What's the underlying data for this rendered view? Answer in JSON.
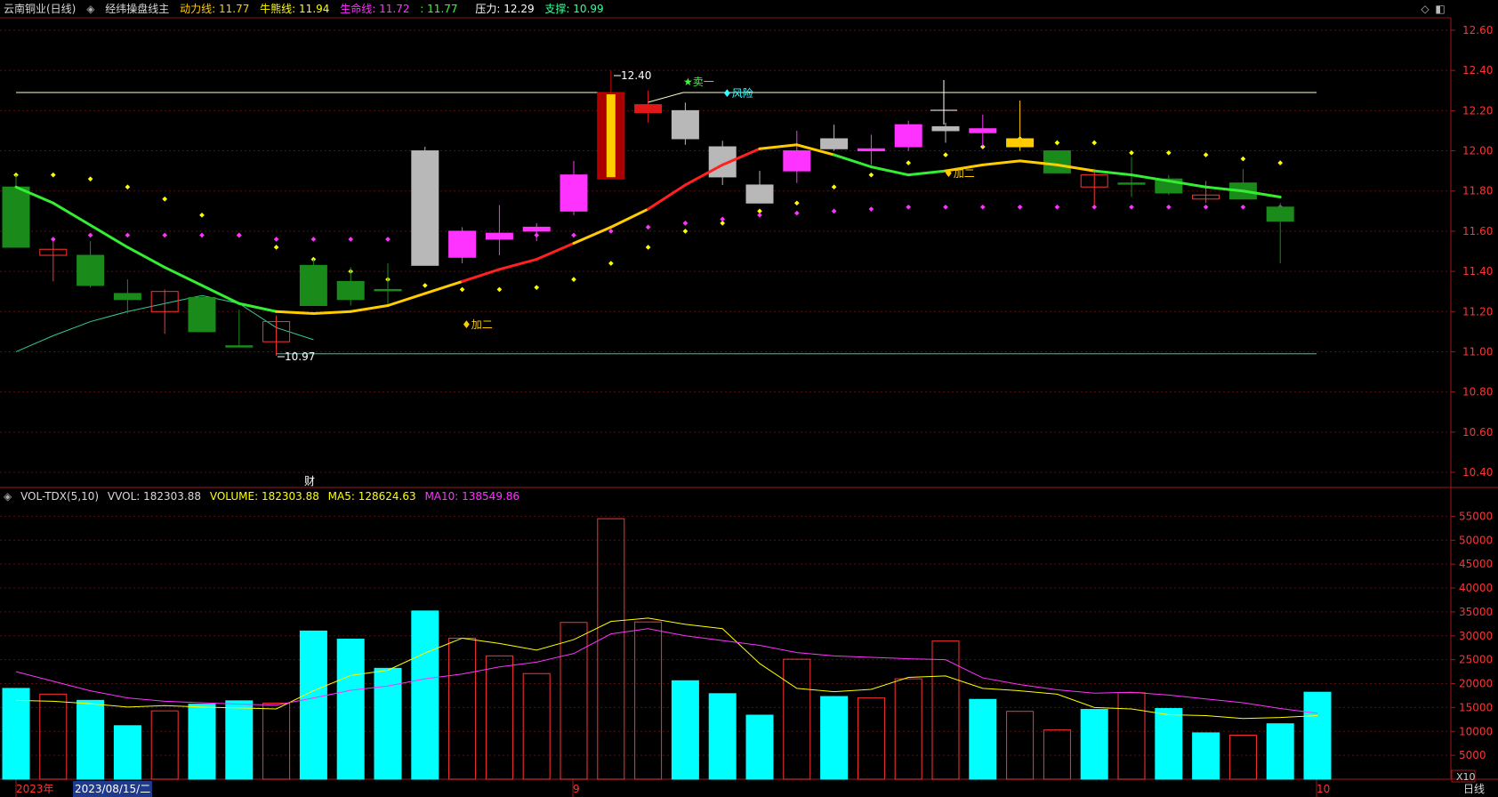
{
  "header": {
    "title": "云南铜业(日线)",
    "indicator_name": "经纬操盘线主",
    "dynamic_label": "动力线:",
    "dynamic_value": "11.77",
    "bull_label": "牛熊线:",
    "bull_value": "11.94",
    "life_label": "生命线:",
    "life_value": "11.72",
    "extra_label": ":",
    "extra_value": "11.77",
    "resist_label": "压力:",
    "resist_value": "12.29",
    "support_label": "支撑:",
    "support_value": "10.99",
    "colors": {
      "dynamic": "#ffcc00",
      "bull": "#ffff00",
      "life": "#ff33ff",
      "extra": "#33ff33",
      "resist": "#ffffff",
      "support": "#33ff99"
    }
  },
  "price_axis": {
    "ticks": [
      "12.60",
      "12.40",
      "12.20",
      "12.00",
      "11.80",
      "11.60",
      "11.40",
      "11.20",
      "11.00",
      "10.80",
      "10.60",
      "10.40"
    ]
  },
  "annotations": {
    "high": "12.40",
    "low": "10.97",
    "sell1": "★卖一",
    "risk": "♦风险",
    "add2_a": "♦加二",
    "add2_b": "♦加二",
    "finance": "财"
  },
  "volume": {
    "name": "VOL-TDX(5,10)",
    "vvol": "VVOL: 182303.88",
    "volume": "VOLUME: 182303.88",
    "ma5": "MA5: 128624.63",
    "ma10": "MA10: 138549.86",
    "axis_ticks": [
      "55000",
      "50000",
      "45000",
      "40000",
      "35000",
      "30000",
      "25000",
      "20000",
      "15000",
      "10000",
      "5000"
    ],
    "unit": "X10"
  },
  "datebar": {
    "year": "2023年",
    "cursor_date": "2023/08/15/二",
    "month9": "9",
    "month10": "10",
    "period": "日线"
  },
  "colors": {
    "up": "#ff3333",
    "down_green": "#1a8a1a",
    "magenta": "#ff33ff",
    "cyan": "#00ffff",
    "yellow": "#ffff00",
    "gray": "#aaaaaa"
  },
  "chart_data": {
    "type": "candlestick",
    "ylim": [
      10.4,
      12.6
    ],
    "candles": [
      {
        "o": 11.82,
        "h": 11.88,
        "l": 11.52,
        "c": 11.52,
        "col": "green"
      },
      {
        "o": 11.48,
        "h": 11.55,
        "l": 11.35,
        "c": 11.51,
        "col": "redh"
      },
      {
        "o": 11.48,
        "h": 11.55,
        "l": 11.32,
        "c": 11.33,
        "col": "green"
      },
      {
        "o": 11.29,
        "h": 11.36,
        "l": 11.19,
        "c": 11.26,
        "col": "green"
      },
      {
        "o": 11.2,
        "h": 11.31,
        "l": 11.09,
        "c": 11.3,
        "col": "redh"
      },
      {
        "o": 11.27,
        "h": 11.28,
        "l": 11.1,
        "c": 11.1,
        "col": "green"
      },
      {
        "o": 11.03,
        "h": 11.21,
        "l": 11.03,
        "c": 11.03,
        "col": "green"
      },
      {
        "o": 11.05,
        "h": 11.18,
        "l": 10.98,
        "c": 11.15,
        "col": "redh"
      },
      {
        "o": 11.43,
        "h": 11.46,
        "l": 11.23,
        "c": 11.23,
        "col": "green"
      },
      {
        "o": 11.35,
        "h": 11.42,
        "l": 11.23,
        "c": 11.26,
        "col": "green"
      },
      {
        "o": 11.31,
        "h": 11.44,
        "l": 11.23,
        "c": 11.31,
        "col": "green"
      },
      {
        "o": 11.43,
        "h": 12.02,
        "l": 11.43,
        "c": 12.0,
        "col": "gray"
      },
      {
        "o": 11.47,
        "h": 11.62,
        "l": 11.44,
        "c": 11.6,
        "col": "magenta"
      },
      {
        "o": 11.56,
        "h": 11.73,
        "l": 11.48,
        "c": 11.59,
        "col": "magenta"
      },
      {
        "o": 11.6,
        "h": 11.64,
        "l": 11.55,
        "c": 11.62,
        "col": "magenta"
      },
      {
        "o": 11.7,
        "h": 11.95,
        "l": 11.68,
        "c": 11.88,
        "col": "magenta"
      },
      {
        "o": 11.86,
        "h": 12.4,
        "l": 11.86,
        "c": 12.29,
        "col": "bigred"
      },
      {
        "o": 12.23,
        "h": 12.3,
        "l": 12.14,
        "c": 12.19,
        "col": "red"
      },
      {
        "o": 12.2,
        "h": 12.24,
        "l": 12.03,
        "c": 12.06,
        "col": "gray"
      },
      {
        "o": 12.02,
        "h": 12.05,
        "l": 11.83,
        "c": 11.87,
        "col": "gray"
      },
      {
        "o": 11.83,
        "h": 11.9,
        "l": 11.74,
        "c": 11.74,
        "col": "gray"
      },
      {
        "o": 11.9,
        "h": 12.1,
        "l": 11.84,
        "c": 12.0,
        "col": "magenta"
      },
      {
        "o": 12.06,
        "h": 12.13,
        "l": 12.0,
        "c": 12.01,
        "col": "gray"
      },
      {
        "o": 12.0,
        "h": 12.08,
        "l": 11.93,
        "c": 12.01,
        "col": "magenta"
      },
      {
        "o": 12.02,
        "h": 12.15,
        "l": 12.0,
        "c": 12.13,
        "col": "magenta"
      },
      {
        "o": 12.12,
        "h": 12.14,
        "l": 12.04,
        "c": 12.1,
        "col": "gray"
      },
      {
        "o": 12.09,
        "h": 12.18,
        "l": 12.02,
        "c": 12.11,
        "col": "magenta"
      },
      {
        "o": 12.06,
        "h": 12.25,
        "l": 12.0,
        "c": 12.02,
        "col": "gold"
      },
      {
        "o": 12.0,
        "h": 12.0,
        "l": 11.89,
        "c": 11.89,
        "col": "green"
      },
      {
        "o": 11.82,
        "h": 11.91,
        "l": 11.73,
        "c": 11.88,
        "col": "redh"
      },
      {
        "o": 11.84,
        "h": 11.97,
        "l": 11.77,
        "c": 11.84,
        "col": "green"
      },
      {
        "o": 11.86,
        "h": 11.88,
        "l": 11.78,
        "c": 11.79,
        "col": "green"
      },
      {
        "o": 11.76,
        "h": 11.85,
        "l": 11.74,
        "c": 11.78,
        "col": "redh"
      },
      {
        "o": 11.84,
        "h": 11.91,
        "l": 11.76,
        "c": 11.76,
        "col": "green"
      },
      {
        "o": 11.72,
        "h": 11.74,
        "l": 11.44,
        "c": 11.65,
        "col": "green"
      }
    ],
    "ma_line": [
      11.82,
      11.74,
      11.63,
      11.52,
      11.42,
      11.33,
      11.24,
      11.2,
      11.19,
      11.2,
      11.23,
      11.29,
      11.35,
      11.41,
      11.46,
      11.54,
      11.62,
      11.71,
      11.83,
      11.93,
      12.01,
      12.03,
      11.98,
      11.92,
      11.88,
      11.9,
      11.93,
      11.95,
      11.93,
      11.9,
      11.88,
      11.85,
      11.82,
      11.8,
      11.77
    ],
    "ma_line_color": [
      "g",
      "g",
      "g",
      "g",
      "g",
      "g",
      "g",
      "g",
      "y",
      "y",
      "y",
      "y",
      "y",
      "r",
      "r",
      "r",
      "y",
      "y",
      "r",
      "r",
      "r",
      "y",
      "y",
      "g",
      "g",
      "g",
      "y",
      "y",
      "y",
      "y",
      "g",
      "g",
      "g",
      "g",
      "g"
    ],
    "support_curve": [
      11.0,
      11.08,
      11.15,
      11.2,
      11.24,
      11.28,
      11.24,
      11.12,
      11.06
    ],
    "yellow_dots": [
      11.88,
      11.88,
      11.86,
      11.82,
      11.76,
      11.68,
      11.58,
      11.52,
      11.46,
      11.4,
      11.36,
      11.33,
      11.31,
      11.31,
      11.32,
      11.36,
      11.44,
      11.52,
      11.6,
      11.64,
      11.7,
      11.74,
      11.82,
      11.88,
      11.94,
      11.98,
      12.02,
      12.06,
      12.04,
      12.04,
      11.99,
      11.99,
      11.98,
      11.96,
      11.94
    ],
    "magenta_dots": [
      11.56,
      11.56,
      11.58,
      11.58,
      11.58,
      11.58,
      11.58,
      11.56,
      11.56,
      11.56,
      11.56,
      11.58,
      11.58,
      11.58,
      11.58,
      11.58,
      11.6,
      11.62,
      11.64,
      11.66,
      11.68,
      11.69,
      11.7,
      11.71,
      11.72,
      11.72,
      11.72,
      11.72,
      11.72,
      11.72,
      11.72,
      11.72,
      11.72,
      11.72,
      11.72
    ],
    "resist_level": 12.29,
    "support_level": 10.99,
    "vol_ylim": [
      0,
      57500
    ],
    "vol_bars": [
      19000,
      17800,
      16500,
      11200,
      14300,
      15700,
      16400,
      15900,
      31000,
      29300,
      23200,
      35200,
      29500,
      25800,
      22100,
      32800,
      54500,
      32900,
      20600,
      17900,
      13400,
      25100,
      17300,
      17000,
      21000,
      28900,
      16700,
      14200,
      10300,
      14600,
      18100,
      14800,
      9700,
      9200,
      11600,
      18200
    ],
    "vol_colors": [
      "c",
      "r",
      "c",
      "c",
      "r",
      "c",
      "c",
      "r",
      "c",
      "c",
      "c",
      "c",
      "r",
      "r",
      "r",
      "r",
      "r",
      "r",
      "c",
      "c",
      "c",
      "r",
      "c",
      "r",
      "r",
      "r",
      "c",
      "r",
      "r",
      "c",
      "r",
      "c",
      "c",
      "r",
      "c",
      "c"
    ],
    "vol_ma5": [
      16500,
      16300,
      15800,
      15100,
      15400,
      15100,
      14900,
      14700,
      18500,
      21700,
      22800,
      26400,
      29500,
      28400,
      27000,
      29200,
      33000,
      33700,
      32400,
      31500,
      24200,
      19000,
      18300,
      18800,
      21300,
      21600,
      19000,
      18500,
      17800,
      15000,
      14700,
      13500,
      13300,
      12700,
      12900,
      13300
    ],
    "vol_ma10": [
      22500,
      20500,
      18500,
      17000,
      16300,
      16000,
      15700,
      15500,
      17000,
      18600,
      19500,
      21000,
      22000,
      23500,
      24500,
      26300,
      30400,
      31500,
      30000,
      29000,
      28000,
      26500,
      25800,
      25500,
      25200,
      25000,
      21200,
      19800,
      18700,
      18000,
      18200,
      17600,
      16800,
      16000,
      14800,
      13800
    ]
  }
}
